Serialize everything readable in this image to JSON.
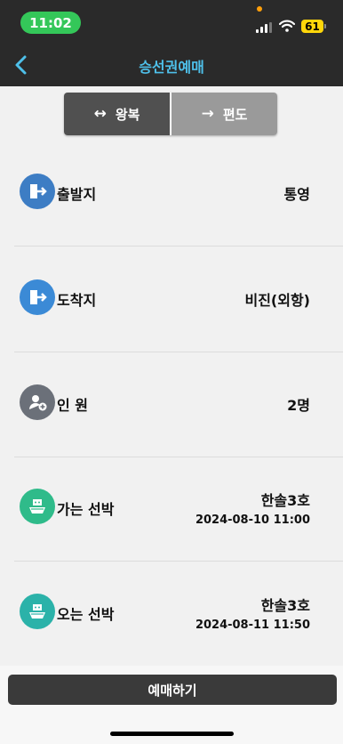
{
  "status": {
    "time": "11:02",
    "battery": "61"
  },
  "header": {
    "title": "승선권예매"
  },
  "trip_toggle": {
    "round_trip": "왕복",
    "one_way": "편도",
    "round_trip_arrow": "↔",
    "one_way_arrow": "→",
    "active": "round_trip"
  },
  "rows": {
    "departure": {
      "label": "출발지",
      "value": "통영"
    },
    "arrival": {
      "label": "도착지",
      "value": "비진(외항)"
    },
    "passengers": {
      "label": "인 원",
      "value": "2명"
    },
    "outbound": {
      "label": "가는 선박",
      "ship": "한솔3호",
      "datetime": "2024-08-10 11:00"
    },
    "return": {
      "label": "오는 선박",
      "ship": "한솔3호",
      "datetime": "2024-08-11 11:50"
    }
  },
  "actions": {
    "reserve": "예매하기"
  },
  "colors": {
    "header_bg": "#2a2a2a",
    "accent": "#4ec0ea",
    "time_pill": "#34c759",
    "battery": "#ffd60a"
  }
}
